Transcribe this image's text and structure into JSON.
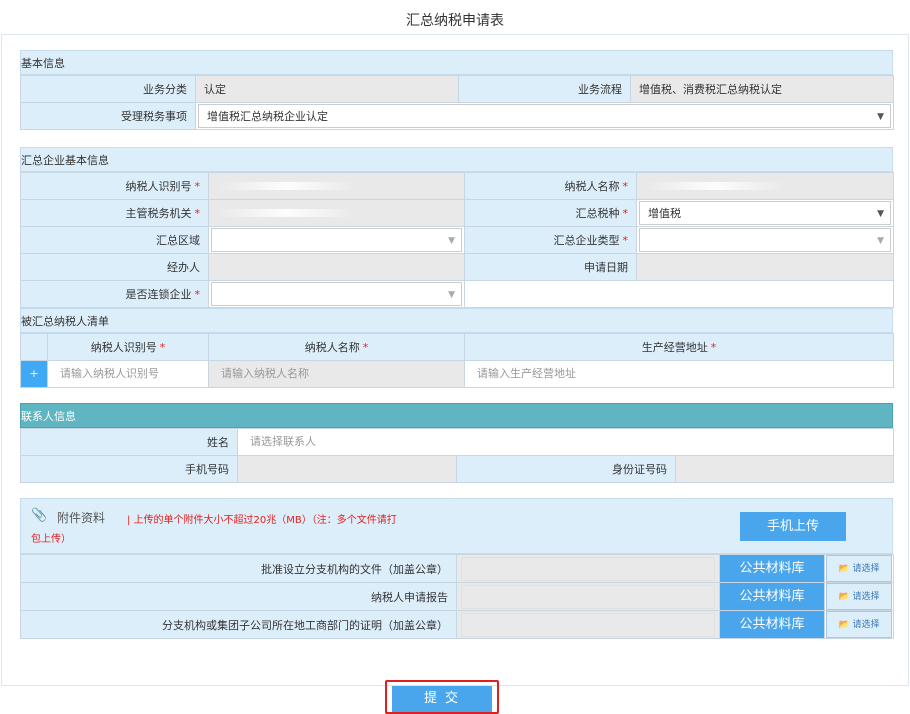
{
  "page_title": "汇总纳税申请表",
  "basic": {
    "header": "基本信息",
    "biz_category_label": "业务分类",
    "biz_category_value": "认定",
    "biz_flow_label": "业务流程",
    "biz_flow_value": "增值税、消费税汇总纳税认定",
    "matter_label": "受理税务事项",
    "matter_value": "增值税汇总纳税企业认定"
  },
  "enterprise": {
    "header": "汇总企业基本信息",
    "taxpayer_id_label": "纳税人识别号",
    "taxpayer_name_label": "纳税人名称",
    "tax_office_label": "主管税务机关",
    "tax_type_label": "汇总税种",
    "tax_type_value": "增值税",
    "region_label": "汇总区域",
    "ent_type_label": "汇总企业类型",
    "handler_label": "经办人",
    "apply_date_label": "申请日期",
    "chain_label": "是否连锁企业",
    "required_mark": "*"
  },
  "members": {
    "header": "被汇总纳税人清单",
    "col_id": "纳税人识别号",
    "col_name": "纳税人名称",
    "col_addr": "生产经营地址",
    "add_label": "+",
    "ph_id": "请输入纳税人识别号",
    "ph_name": "请输入纳税人名称",
    "ph_addr": "请输入生产经营地址"
  },
  "contact": {
    "header": "联系人信息",
    "name_label": "姓名",
    "name_placeholder": "请选择联系人",
    "phone_label": "手机号码",
    "idno_label": "身份证号码"
  },
  "attachments": {
    "title": "附件资料",
    "note": "| 上传的单个附件大小不超过20兆（MB）（注：多个文件请打包上传）",
    "note_line1": "| 上传的单个附件大小不超过20兆（MB）（注：多个文件请打",
    "note_line2": "包上传）",
    "mobile_upload": "手机上传",
    "public_lib": "公共材料库",
    "pick": "请选择",
    "items": [
      "批准设立分支机构的文件（加盖公章）",
      "纳税人申请报告",
      "分支机构或集团子公司所在地工商部门的证明（加盖公章）"
    ]
  },
  "submit_label": "提交",
  "colors": {
    "accent": "#4aa6ec",
    "header_bg": "#ddeefb",
    "teal": "#5fb5c2",
    "required": "#e02020"
  }
}
